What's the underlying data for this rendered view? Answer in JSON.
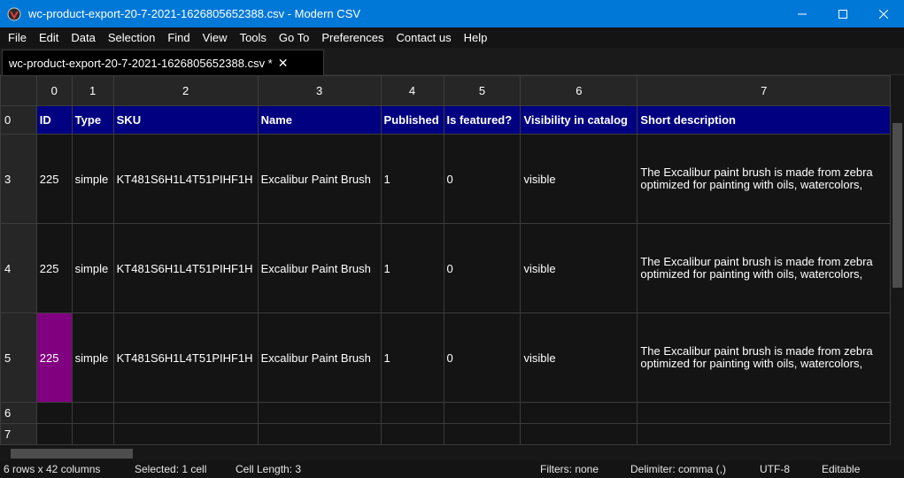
{
  "window": {
    "title": "wc-product-export-20-7-2021-1626805652388.csv - Modern CSV",
    "app_icon": "modern-csv-logo-icon",
    "controls": [
      "minimize-icon",
      "maximize-icon",
      "close-icon"
    ]
  },
  "menu": [
    "File",
    "Edit",
    "Data",
    "Selection",
    "Find",
    "View",
    "Tools",
    "Go To",
    "Preferences",
    "Contact us",
    "Help"
  ],
  "tab": {
    "label": "wc-product-export-20-7-2021-1626805652388.csv *",
    "close": "✕"
  },
  "grid": {
    "column_numbers": [
      "0",
      "1",
      "2",
      "3",
      "4",
      "5",
      "6",
      "7"
    ],
    "header_row": {
      "row_number": "0",
      "cells": [
        "ID",
        "Type",
        "SKU",
        "Name",
        "Published",
        "Is featured?",
        "Visibility in catalog",
        "Short description"
      ]
    },
    "data_rows": [
      {
        "row_number": "3",
        "cells": [
          "225",
          "simple",
          "KT481S6H1L4T51PIHF1H",
          "Excalibur Paint Brush",
          "1",
          "0",
          "visible"
        ],
        "description": [
          "The Excalibur paint brush is made from zebra",
          "optimized for painting with oils, watercolors,"
        ]
      },
      {
        "row_number": "4",
        "cells": [
          "225",
          "simple",
          "KT481S6H1L4T51PIHF1H",
          "Excalibur Paint Brush",
          "1",
          "0",
          "visible"
        ],
        "description": [
          "The Excalibur paint brush is made from zebra",
          "optimized for painting with oils, watercolors,"
        ]
      },
      {
        "row_number": "5",
        "cells": [
          "225",
          "simple",
          "KT481S6H1L4T51PIHF1H",
          "Excalibur Paint Brush",
          "1",
          "0",
          "visible"
        ],
        "description": [
          "The Excalibur paint brush is made from zebra",
          "optimized for painting with oils, watercolors,"
        ]
      }
    ],
    "empty_rows": [
      "6",
      "7"
    ],
    "selected_cell": {
      "row": "5",
      "column": "0"
    }
  },
  "status": {
    "size": "6 rows x 42 columns",
    "selected": "Selected: 1 cell",
    "cell_length": "Cell Length: 3",
    "filters": "Filters: none",
    "delimiter": "Delimiter: comma (,)",
    "encoding": "UTF-8",
    "mode": "Editable"
  },
  "colors": {
    "title_bar": "#0078d7",
    "header_row_bg": "#000080",
    "selected_cell_bg": "#800080",
    "background": "#141414"
  }
}
